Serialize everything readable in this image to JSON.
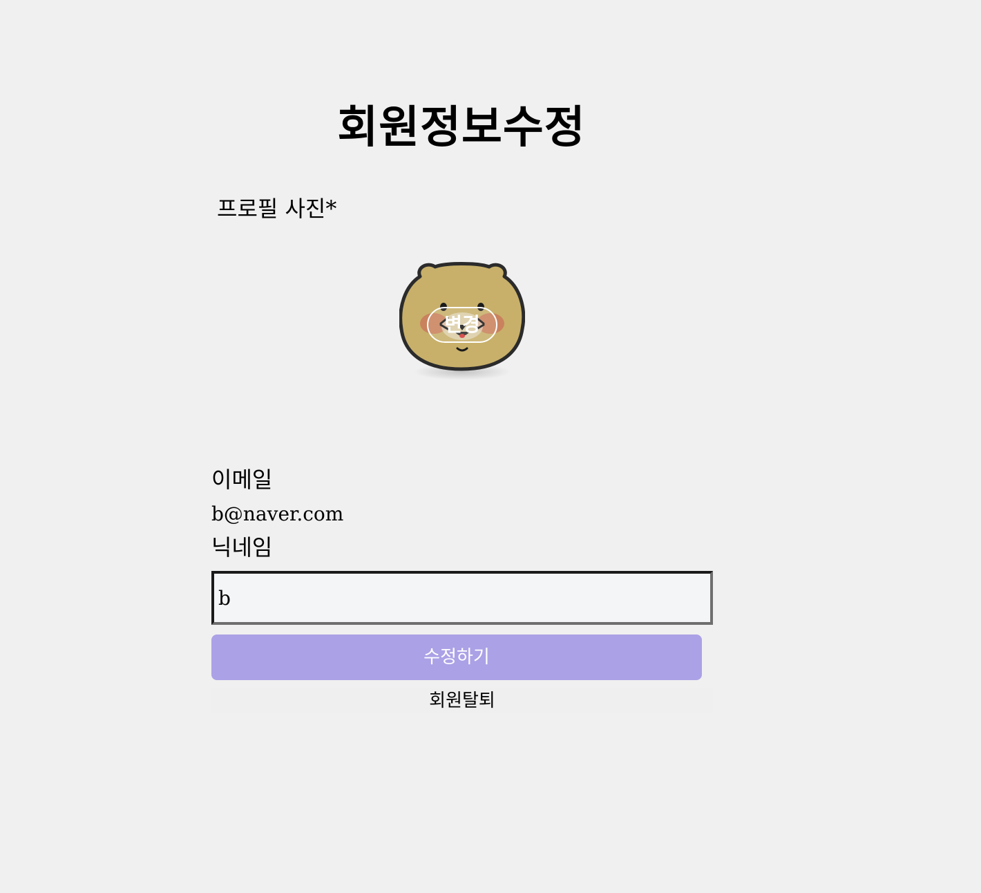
{
  "page": {
    "title": "회원정보수정"
  },
  "profile": {
    "label": "프로필 사진*",
    "change_label": "변경",
    "avatar_icon": "bear-face-icon"
  },
  "email": {
    "label": "이메일",
    "value": "b@naver.com"
  },
  "nickname": {
    "label": "닉네임",
    "value": "b"
  },
  "actions": {
    "submit_label": "수정하기",
    "withdraw_label": "회원탈퇴"
  },
  "colors": {
    "background": "#f0f0f0",
    "submit_button": "#aba1e6",
    "avatar_fur": "#c8b06a",
    "avatar_cheeks": "#c97a5a"
  }
}
